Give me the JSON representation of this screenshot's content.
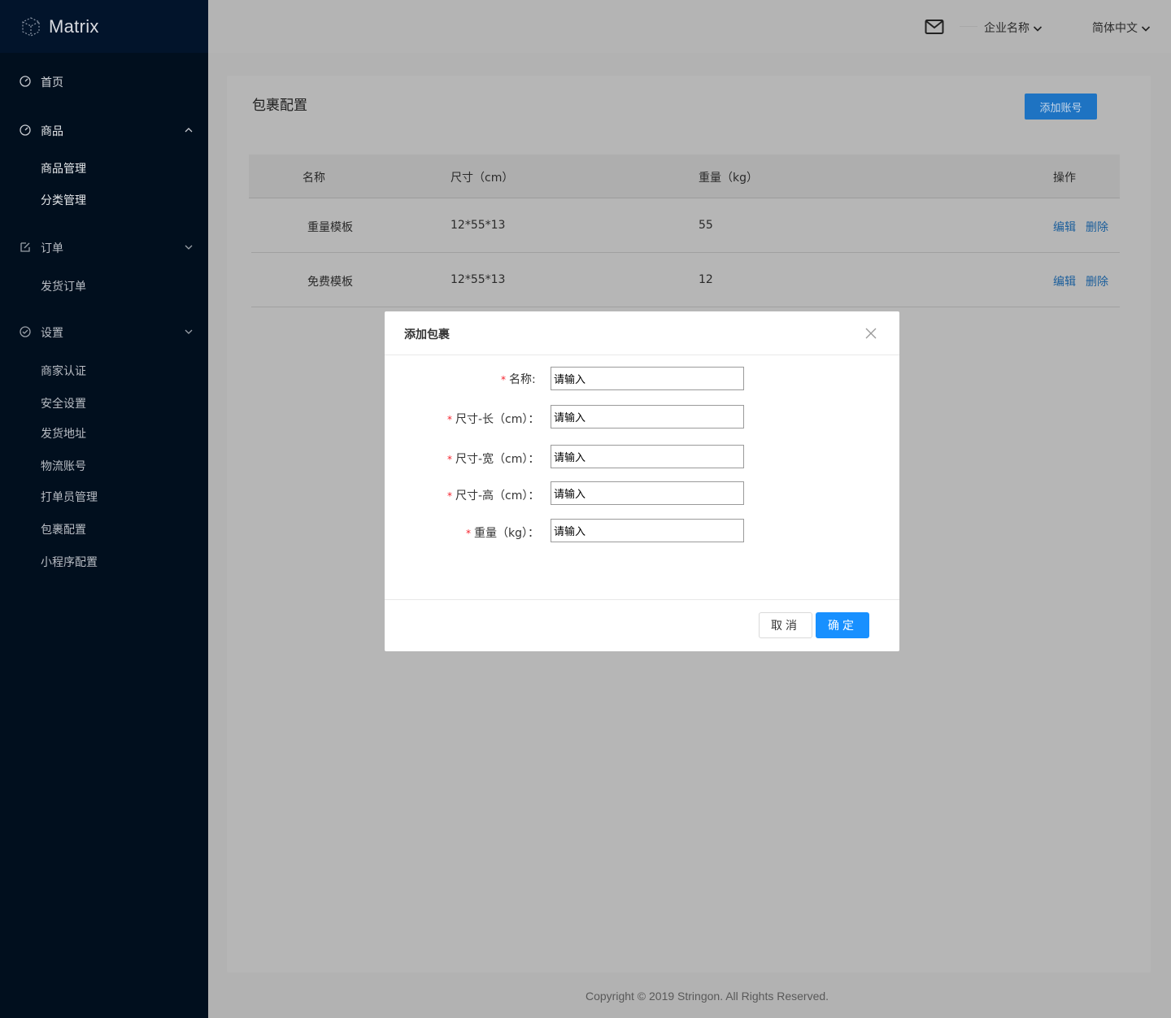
{
  "app": {
    "logo_text": "Matrix"
  },
  "sidebar": {
    "home": "首页",
    "goods": {
      "label": "商品",
      "items": [
        "商品管理",
        "分类管理"
      ]
    },
    "orders": {
      "label": "订单",
      "items": [
        "发货订单"
      ]
    },
    "settings": {
      "label": "设置",
      "items": [
        "商家认证",
        "安全设置",
        "发货地址",
        "物流账号",
        "打单员管理",
        "包裹配置",
        "小程序配置"
      ]
    }
  },
  "header": {
    "company": "企业名称",
    "language": "简体中文"
  },
  "page": {
    "title": "包裹配置",
    "add_button": "添加账号",
    "columns": [
      "名称",
      "尺寸（cm）",
      "重量（kg）",
      "操作"
    ],
    "rows": [
      {
        "name": "重量模板",
        "size": "12*55*13",
        "weight": "55",
        "edit": "编辑",
        "delete": "删除"
      },
      {
        "name": "免费模板",
        "size": "12*55*13",
        "weight": "12",
        "edit": "编辑",
        "delete": "删除"
      }
    ]
  },
  "modal": {
    "title": "添加包裹",
    "fields": [
      {
        "label": "名称:",
        "placeholder": "请输入"
      },
      {
        "label": "尺寸-长（cm）：",
        "placeholder": "请输入"
      },
      {
        "label": "尺寸-宽（cm）：",
        "placeholder": "请输入"
      },
      {
        "label": "尺寸-高（cm）：",
        "placeholder": "请输入"
      },
      {
        "label": "重量（kg）：",
        "placeholder": "请输入"
      }
    ],
    "cancel": "取消",
    "ok": "确定"
  },
  "footer": {
    "copyright": "Copyright © 2019 Stringon. All Rights Reserved."
  },
  "colors": {
    "sidebar_bg": "#010f1e",
    "primary": "#1890ff",
    "overlay": "#b2b2b2"
  }
}
